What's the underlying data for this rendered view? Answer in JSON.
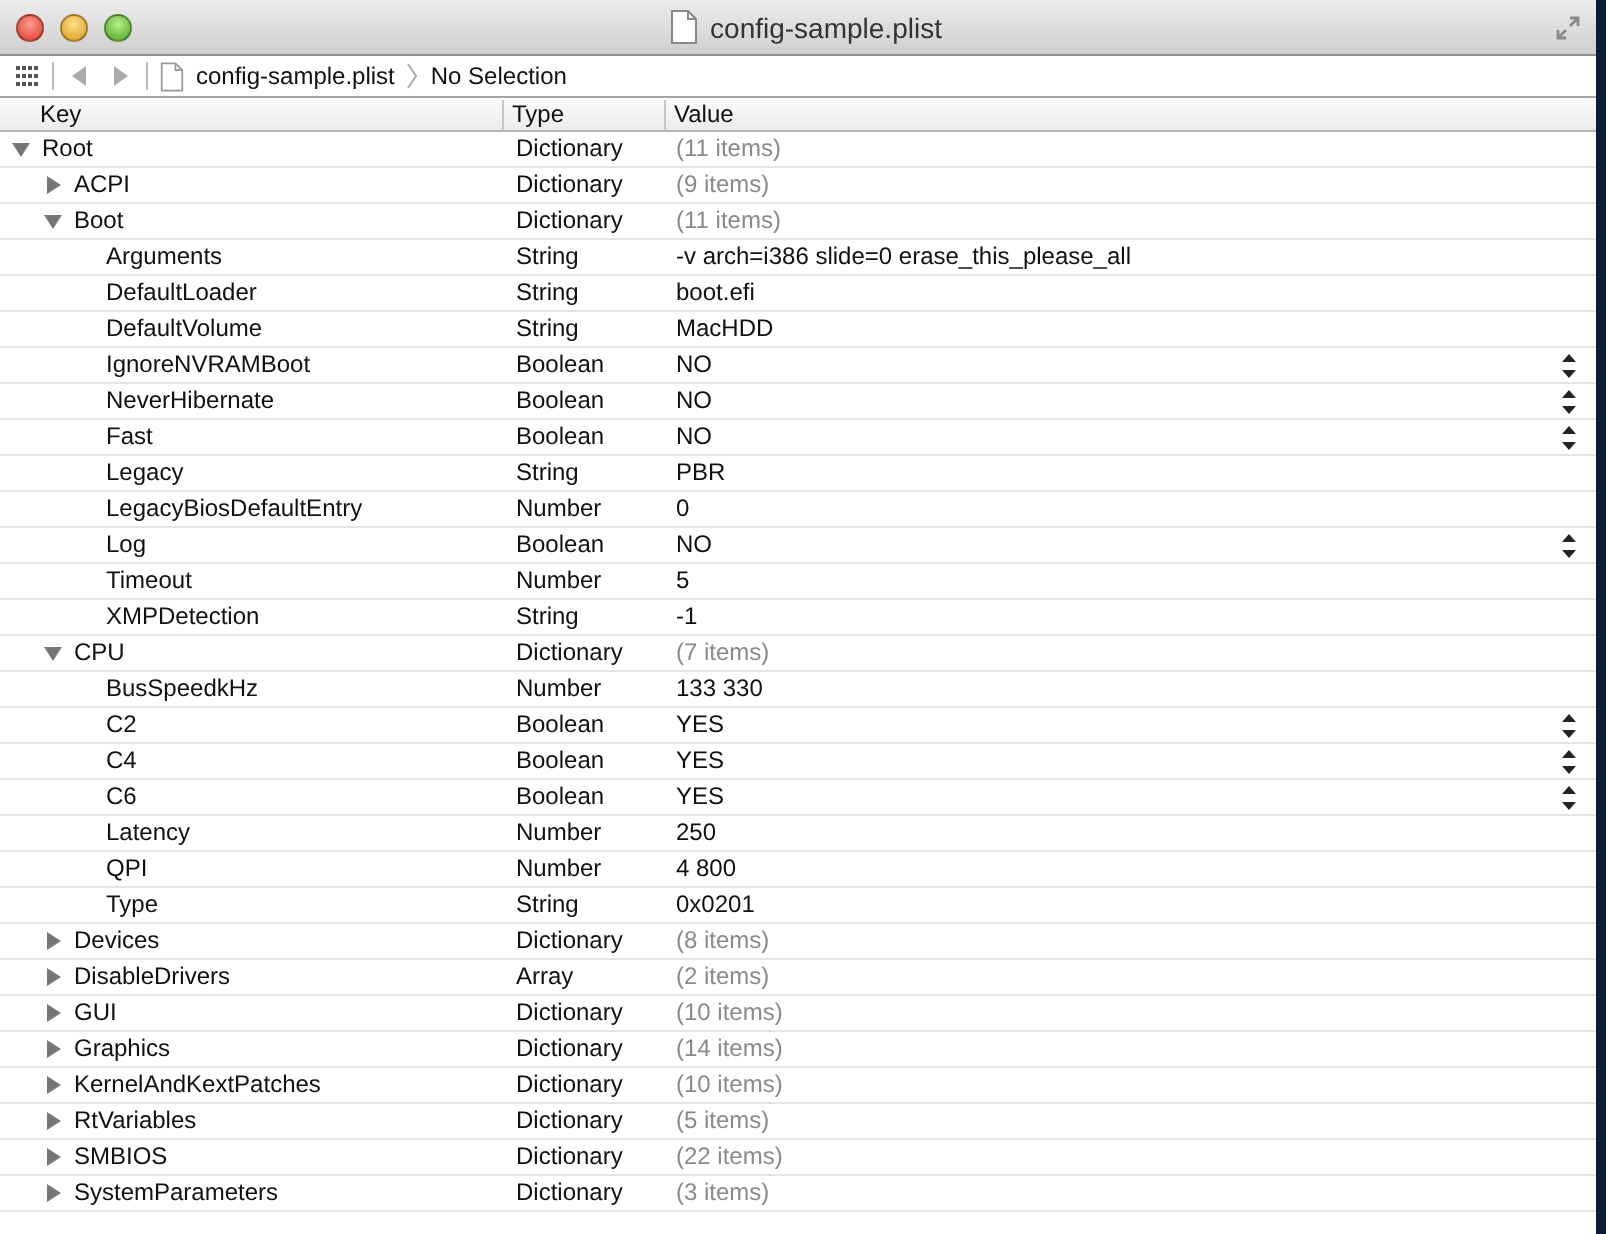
{
  "window": {
    "title": "config-sample.plist"
  },
  "jump_bar": {
    "file": "config-sample.plist",
    "selection": "No Selection"
  },
  "table": {
    "columns": [
      "Key",
      "Type",
      "Value"
    ],
    "rows": [
      {
        "key": "Root",
        "type": "Dictionary",
        "value": "(11 items)",
        "kind": "container",
        "expanded": true,
        "children": [
          {
            "key": "ACPI",
            "type": "Dictionary",
            "value": "(9 items)",
            "kind": "container",
            "expanded": false
          },
          {
            "key": "Boot",
            "type": "Dictionary",
            "value": "(11 items)",
            "kind": "container",
            "expanded": true,
            "children": [
              {
                "key": "Arguments",
                "type": "String",
                "value": "-v arch=i386 slide=0 erase_this_please_all",
                "kind": "value"
              },
              {
                "key": "DefaultLoader",
                "type": "String",
                "value": "boot.efi",
                "kind": "value"
              },
              {
                "key": "DefaultVolume",
                "type": "String",
                "value": "MacHDD",
                "kind": "value"
              },
              {
                "key": "IgnoreNVRAMBoot",
                "type": "Boolean",
                "value": "NO",
                "kind": "boolean"
              },
              {
                "key": "NeverHibernate",
                "type": "Boolean",
                "value": "NO",
                "kind": "boolean"
              },
              {
                "key": "Fast",
                "type": "Boolean",
                "value": "NO",
                "kind": "boolean"
              },
              {
                "key": "Legacy",
                "type": "String",
                "value": "PBR",
                "kind": "value"
              },
              {
                "key": "LegacyBiosDefaultEntry",
                "type": "Number",
                "value": "0",
                "kind": "value"
              },
              {
                "key": "Log",
                "type": "Boolean",
                "value": "NO",
                "kind": "boolean"
              },
              {
                "key": "Timeout",
                "type": "Number",
                "value": "5",
                "kind": "value"
              },
              {
                "key": "XMPDetection",
                "type": "String",
                "value": "-1",
                "kind": "value"
              }
            ]
          },
          {
            "key": "CPU",
            "type": "Dictionary",
            "value": "(7 items)",
            "kind": "container",
            "expanded": true,
            "children": [
              {
                "key": "BusSpeedkHz",
                "type": "Number",
                "value": "133 330",
                "kind": "value"
              },
              {
                "key": "C2",
                "type": "Boolean",
                "value": "YES",
                "kind": "boolean"
              },
              {
                "key": "C4",
                "type": "Boolean",
                "value": "YES",
                "kind": "boolean"
              },
              {
                "key": "C6",
                "type": "Boolean",
                "value": "YES",
                "kind": "boolean"
              },
              {
                "key": "Latency",
                "type": "Number",
                "value": "250",
                "kind": "value"
              },
              {
                "key": "QPI",
                "type": "Number",
                "value": "4 800",
                "kind": "value"
              },
              {
                "key": "Type",
                "type": "String",
                "value": "0x0201",
                "kind": "value"
              }
            ]
          },
          {
            "key": "Devices",
            "type": "Dictionary",
            "value": "(8 items)",
            "kind": "container",
            "expanded": false
          },
          {
            "key": "DisableDrivers",
            "type": "Array",
            "value": "(2 items)",
            "kind": "container",
            "expanded": false
          },
          {
            "key": "GUI",
            "type": "Dictionary",
            "value": "(10 items)",
            "kind": "container",
            "expanded": false
          },
          {
            "key": "Graphics",
            "type": "Dictionary",
            "value": "(14 items)",
            "kind": "container",
            "expanded": false
          },
          {
            "key": "KernelAndKextPatches",
            "type": "Dictionary",
            "value": "(10 items)",
            "kind": "container",
            "expanded": false
          },
          {
            "key": "RtVariables",
            "type": "Dictionary",
            "value": "(5 items)",
            "kind": "container",
            "expanded": false
          },
          {
            "key": "SMBIOS",
            "type": "Dictionary",
            "value": "(22 items)",
            "kind": "container",
            "expanded": false
          },
          {
            "key": "SystemParameters",
            "type": "Dictionary",
            "value": "(3 items)",
            "kind": "container",
            "expanded": false
          }
        ]
      }
    ]
  }
}
